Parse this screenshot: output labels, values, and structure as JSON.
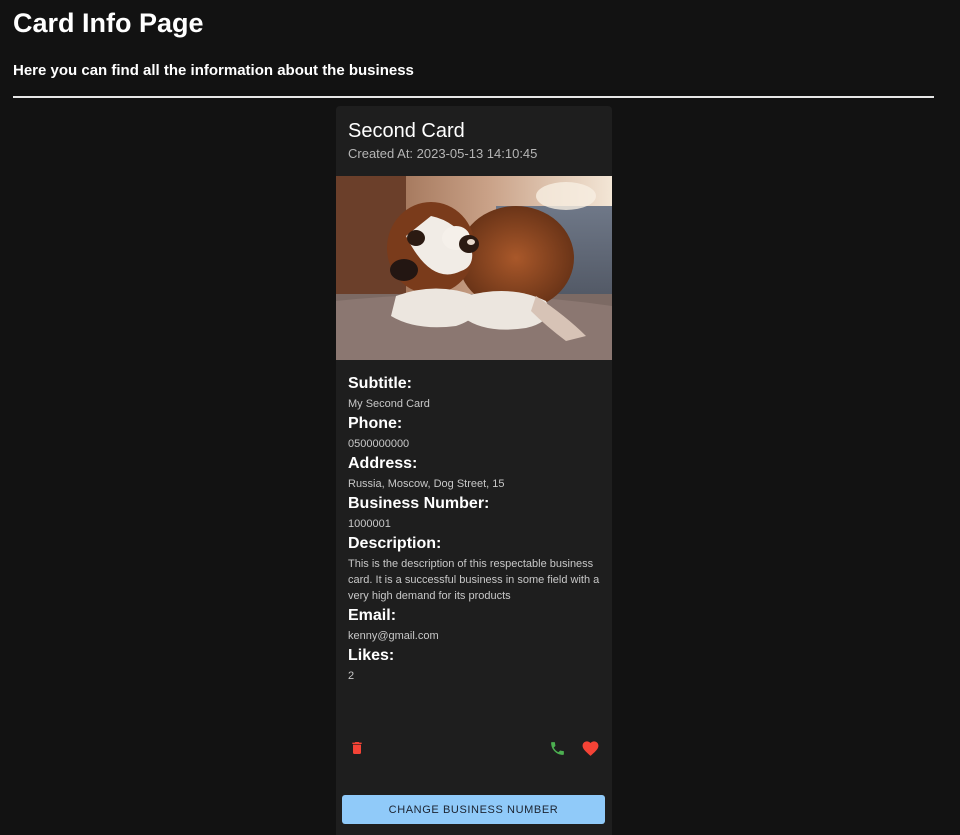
{
  "page": {
    "title": "Card Info Page",
    "subtitle": "Here you can find all the information about the business"
  },
  "card": {
    "title": "Second Card",
    "created_label": "Created At:",
    "created_value": "2023-05-13 14:10:45",
    "fields": [
      {
        "label": "Subtitle:",
        "value": "My Second Card"
      },
      {
        "label": "Phone:",
        "value": "0500000000"
      },
      {
        "label": "Address:",
        "value": "Russia, Moscow, Dog Street, 15"
      },
      {
        "label": "Business Number:",
        "value": "1000001"
      },
      {
        "label": "Description:",
        "value": "This is the description of this respectable business card. It is a successful business in some field with a very high demand for its products"
      },
      {
        "label": "Email:",
        "value": "kenny@gmail.com"
      },
      {
        "label": "Likes:",
        "value": "2"
      }
    ],
    "actions": {
      "delete_icon": "trash-icon",
      "phone_icon": "phone-icon",
      "like_icon": "heart-icon"
    },
    "change_button_label": "Change Business Number"
  },
  "colors": {
    "background": "#121212",
    "card": "#1e1e1e",
    "delete": "#f44336",
    "phone": "#4caf50",
    "like": "#f44336",
    "button": "#90caf9"
  }
}
